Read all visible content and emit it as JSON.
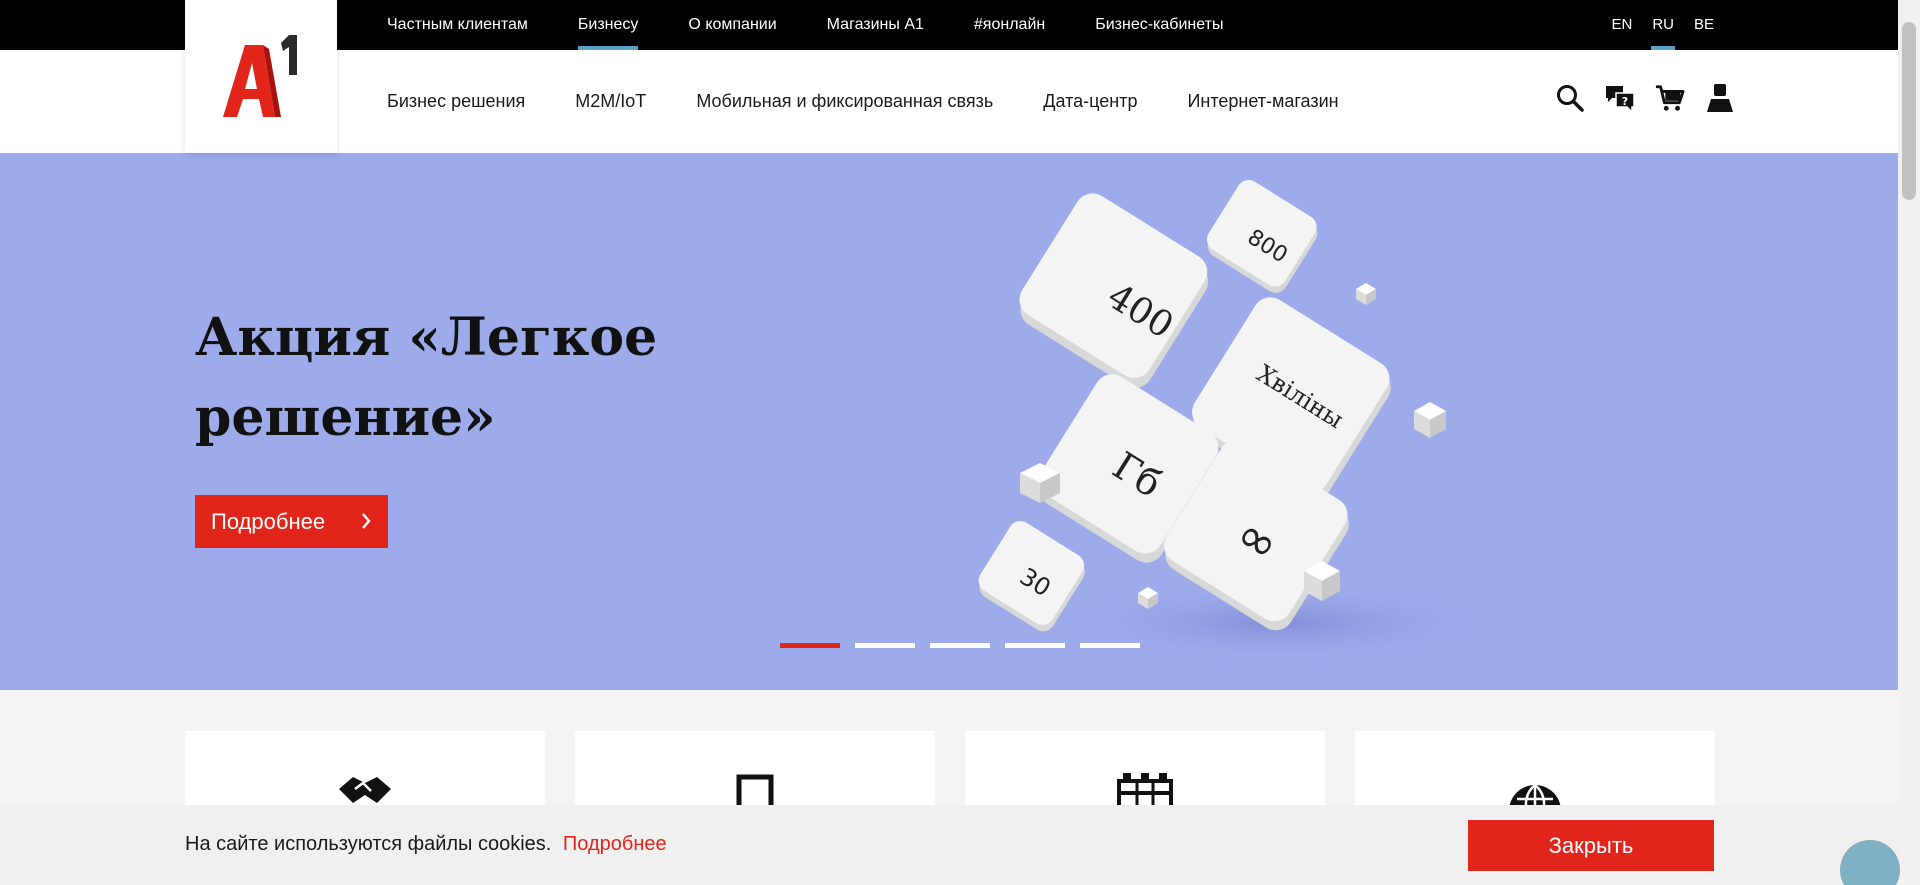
{
  "top_nav": {
    "items": [
      {
        "label": "Частным клиентам"
      },
      {
        "label": "Бизнесу"
      },
      {
        "label": "О компании"
      },
      {
        "label": "Магазины А1"
      },
      {
        "label": "#яонлайн"
      },
      {
        "label": "Бизнес-кабинеты"
      }
    ],
    "active": "Бизнесу"
  },
  "languages": {
    "items": [
      {
        "label": "EN"
      },
      {
        "label": "RU"
      },
      {
        "label": "BE"
      }
    ],
    "active": "RU"
  },
  "logo": {
    "text": "A1"
  },
  "main_nav": {
    "items": [
      {
        "label": "Бизнес решения"
      },
      {
        "label": "M2M/IoT"
      },
      {
        "label": "Мобильная и фиксированная связь"
      },
      {
        "label": "Дата-центр"
      },
      {
        "label": "Интернет-магазин"
      }
    ]
  },
  "header_icons": [
    "search-icon",
    "chat-question-icon",
    "cart-icon",
    "user-icon"
  ],
  "hero": {
    "title": "Акция «Легкое решение»",
    "button_label": "Подробнее",
    "puzzle_labels": [
      "400",
      "800",
      "Хвіліны",
      "Гб",
      "∞",
      "30"
    ],
    "slides_count": 5,
    "active_slide": 1
  },
  "cards": [
    {
      "icon": "handshake-icon"
    },
    {
      "icon": "phone-icon"
    },
    {
      "icon": "server-icon"
    },
    {
      "icon": "globe-icon"
    }
  ],
  "cookie": {
    "text": "На сайте используются файлы cookies.",
    "more_label": "Подробнее",
    "close_label": "Закрыть"
  },
  "colors": {
    "brand_red": "#e1251b",
    "hero_bg": "#9dabeb",
    "active_underline": "#5aa0c8"
  }
}
